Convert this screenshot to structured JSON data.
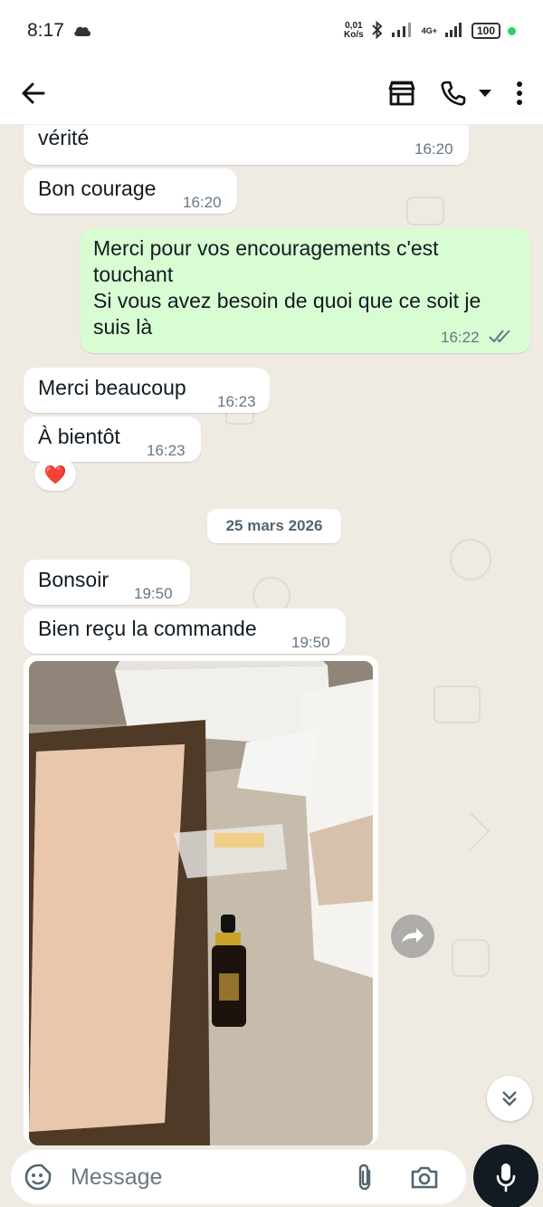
{
  "status_bar": {
    "time": "8:17",
    "net_speed_value": "0,01",
    "net_speed_unit": "Ko/s",
    "network_type": "4G+",
    "battery": "100"
  },
  "header": {
    "back_icon": "arrow-left-icon",
    "store_icon": "storefront-icon",
    "call_icon": "phone-icon",
    "call_dropdown_icon": "caret-down-icon",
    "menu_icon": "kebab-menu-icon"
  },
  "messages": [
    {
      "direction": "in",
      "text": "vérité",
      "time": "16:20"
    },
    {
      "direction": "in",
      "text": "Bon courage",
      "time": "16:20"
    },
    {
      "direction": "out",
      "text_line1": "Merci pour vos encouragements c'est",
      "text_line2": "touchant",
      "text_line3": "Si vous avez besoin de quoi que ce soit je",
      "text_line4": "suis là",
      "time": "16:22",
      "status": "read"
    },
    {
      "direction": "in",
      "text": "Merci beaucoup",
      "time": "16:23"
    },
    {
      "direction": "in",
      "text": "À bientôt",
      "time": "16:23",
      "reaction": "❤️"
    },
    {
      "direction": "in",
      "text": "Bonsoir",
      "time": "19:50"
    },
    {
      "direction": "in",
      "text": "Bien reçu la commande",
      "time": "19:50"
    }
  ],
  "date_separator": "25 mars 2026",
  "composer": {
    "placeholder": "Message",
    "emoji_icon": "emoji-icon",
    "attach_icon": "paperclip-icon",
    "camera_icon": "camera-icon",
    "mic_icon": "microphone-icon"
  },
  "colors": {
    "outgoing_bubble": "#d9fdd3",
    "incoming_bubble": "#ffffff",
    "chat_background": "#efeae2",
    "read_tick": "#667781"
  }
}
